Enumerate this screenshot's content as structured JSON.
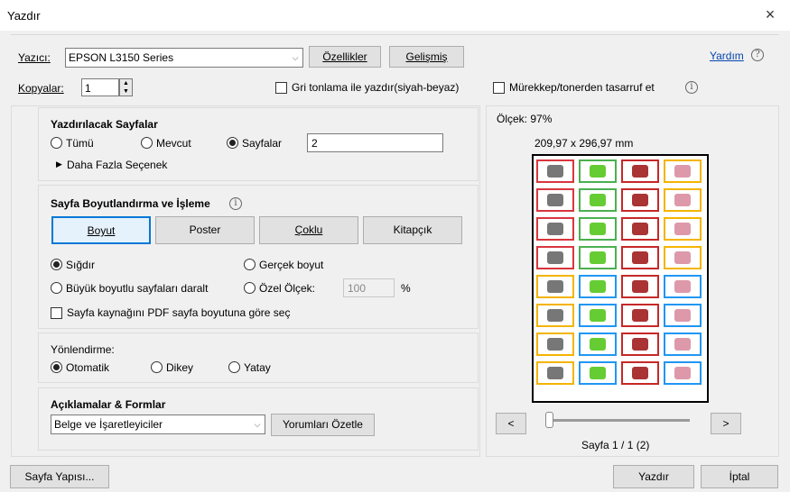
{
  "window": {
    "title": "Yazdır",
    "close_glyph": "×"
  },
  "printer": {
    "label": "Yazıcı:",
    "value": "EPSON L3150 Series",
    "properties_button": "Özellikler",
    "advanced_button": "Gelişmiş",
    "help_link": "Yardım"
  },
  "copies": {
    "label": "Kopyalar:",
    "value": "1",
    "grayscale_label": "Gri tonlama ile yazdır(siyah-beyaz)",
    "grayscale_checked": false,
    "ink_save_label": "Mürekkep/tonerden tasarruf et",
    "ink_save_checked": false
  },
  "pages_section": {
    "title": "Yazdırılacak Sayfalar",
    "all_label": "Tümü",
    "current_label": "Mevcut",
    "pages_label": "Sayfalar",
    "selected": "pages",
    "pages_value": "2",
    "more_options": "Daha Fazla Seçenek"
  },
  "sizing_section": {
    "title": "Sayfa Boyutlandırma ve İşleme",
    "tabs": [
      "Boyut",
      "Poster",
      "Çoklu",
      "Kitapçık"
    ],
    "active_tab": "Boyut",
    "fit_label": "Sığdır",
    "actual_size_label": "Gerçek boyut",
    "shrink_label": "Büyük boyutlu sayfaları daralt",
    "custom_scale_label": "Özel Ölçek:",
    "custom_scale_value": "100",
    "percent_sign": "%",
    "selected": "fit",
    "pdf_source_label": "Sayfa kaynağını PDF sayfa boyutuna göre seç",
    "pdf_source_checked": false
  },
  "orientation_section": {
    "title": "Yönlendirme:",
    "auto_label": "Otomatik",
    "portrait_label": "Dikey",
    "landscape_label": "Yatay",
    "selected": "auto"
  },
  "comments_section": {
    "title": "Açıklamalar & Formlar",
    "value": "Belge ve İşaretleyiciler",
    "summarize_button": "Yorumları Özetle"
  },
  "preview": {
    "scale_label": "Ölçek:",
    "scale_value": "97%",
    "dimensions": "209,97 x 296,97 mm",
    "prev_glyph": "<",
    "next_glyph": ">",
    "page_info": "Sayfa 1 / 1 (2)"
  },
  "footer": {
    "page_setup_button": "Sayfa Yapısı...",
    "print_button": "Yazdır",
    "cancel_button": "İptal"
  },
  "colors": {
    "tile_borders": [
      "#d9363e",
      "#4caf50",
      "#c62828",
      "#f4b400",
      "#9c27b0",
      "#2196f3"
    ]
  }
}
